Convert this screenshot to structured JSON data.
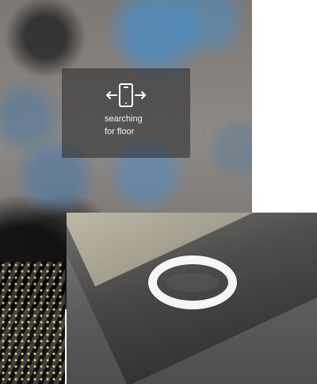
{
  "app": {
    "screens": [
      {
        "name": "search-floor",
        "overlay": {
          "icon": "phone-move-left-right-icon",
          "lines": [
            "searching",
            "for floor"
          ]
        }
      },
      {
        "name": "floor-detected",
        "reticle": "placement-ring"
      }
    ]
  },
  "colors": {
    "overlay_bg": "#1e1e1e",
    "overlay_text": "#f3f3f3",
    "reticle": "#ffffff",
    "floor_blue": "#4a8cc8",
    "floor_gray": "#7c7773"
  }
}
